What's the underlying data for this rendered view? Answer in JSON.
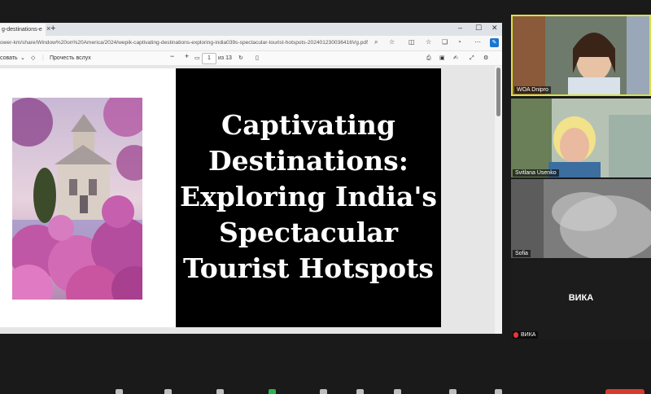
{
  "browser": {
    "tab_title": "g-destinations-e",
    "tab_close": "×",
    "new_tab": "+",
    "window_controls": {
      "minimize": "–",
      "maximize": "☐",
      "close": "✕"
    },
    "url": "ower-km/share/Window%20on%20America/2024/wepik-captivating-destinations-exploring-india039s-spectacular-tourist-hotspots-202401230036416Vg.pdf",
    "icons": [
      "search-icon",
      "star-icon",
      "split-icon",
      "favorites-icon",
      "collections-icon",
      "profile-icon",
      "menu-icon",
      "extension-icon"
    ]
  },
  "pdf_toolbar": {
    "draw_label": "совать",
    "read_aloud_label": "Прочесть вслух",
    "zoom_out": "−",
    "zoom_in": "+",
    "page_current": "1",
    "page_total": "из 13"
  },
  "slide": {
    "title_lines": [
      "Captivating",
      "Destinations:",
      "Exploring India's",
      "Spectacular",
      "Tourist Hotspots"
    ]
  },
  "participants": [
    {
      "name": "WOA Dnipro",
      "active": true
    },
    {
      "name": "Svitlana Usenko",
      "active": false
    },
    {
      "name": "Sofia",
      "active": false
    },
    {
      "name": "ВИКА",
      "center_label": "ВИКА",
      "muted": true
    }
  ],
  "colors": {
    "active_speaker": "#d8e14a",
    "slide_bg": "#000000",
    "end_button": "#d83a2f"
  }
}
